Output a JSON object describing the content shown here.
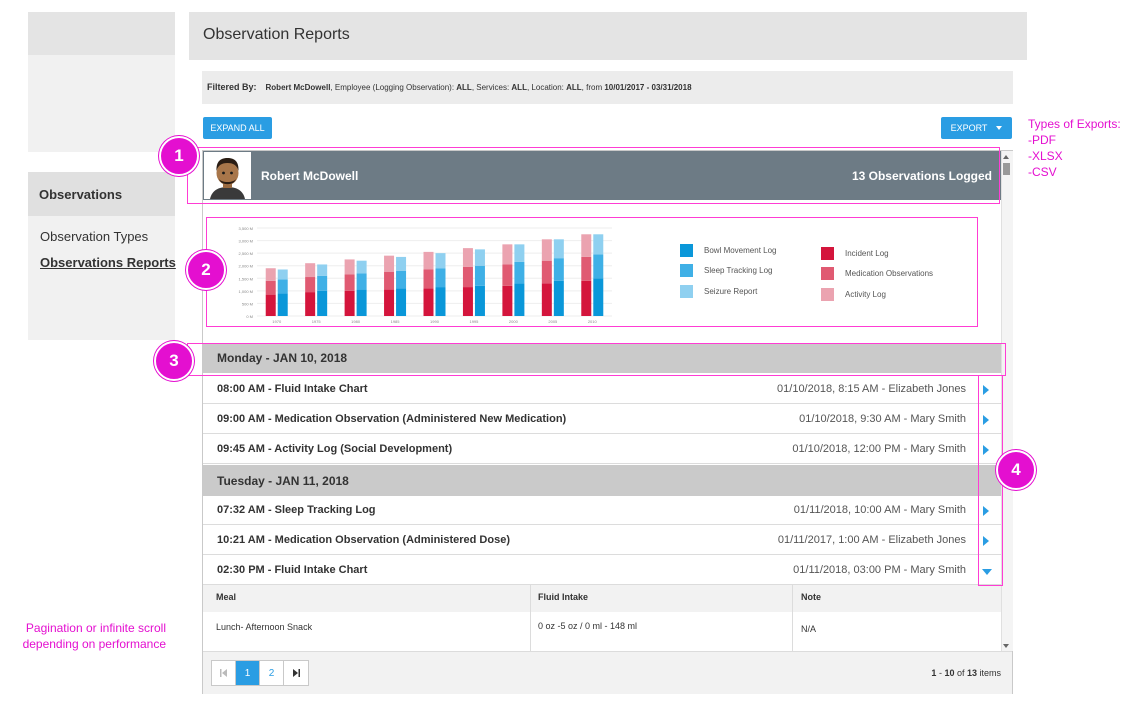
{
  "header": {
    "title": "Observation Reports"
  },
  "nav": {
    "header": "Observations",
    "items": [
      {
        "label": "Observation Types"
      },
      {
        "label": "Observations Reports"
      }
    ]
  },
  "filter": {
    "label": "Filtered By:",
    "name": "Robert McDowell",
    "employee_label": ", Employee (Logging Observation): ",
    "employee_value": "ALL",
    "services_label": ", Services: ",
    "services_value": "ALL",
    "location_label": ", Location: ",
    "location_value": "ALL",
    "from_label": ", from ",
    "date_range": "10/01/2017 - 03/31/2018"
  },
  "buttons": {
    "expand_all": "EXPAND ALL",
    "export": "EXPORT"
  },
  "user": {
    "name": "Robert McDowell",
    "count": "13 Observations Logged"
  },
  "chart_data": {
    "type": "bar",
    "categories": [
      "1970",
      "1975",
      "1980",
      "1985",
      "1990",
      "1995",
      "2000",
      "2005",
      "2010"
    ],
    "yticks": [
      "3,500 M",
      "3,000 M",
      "2,500 M",
      "2,000 M",
      "1,500 M",
      "1,000 M",
      "500 M",
      "0 M"
    ],
    "ylim": [
      0,
      3500
    ],
    "series": [
      {
        "name": "Bowl Movement Log",
        "stack": "b",
        "values": [
          900,
          1000,
          1050,
          1100,
          1150,
          1200,
          1300,
          1400,
          1500
        ]
      },
      {
        "name": "Sleep Tracking Log",
        "stack": "b",
        "values": [
          550,
          600,
          650,
          700,
          750,
          800,
          850,
          900,
          950
        ]
      },
      {
        "name": "Seizure Report",
        "stack": "b",
        "values": [
          400,
          450,
          500,
          550,
          600,
          650,
          700,
          750,
          800
        ]
      },
      {
        "name": "Incident Log",
        "stack": "a",
        "values": [
          850,
          950,
          1000,
          1050,
          1100,
          1150,
          1200,
          1300,
          1400
        ]
      },
      {
        "name": "Medication Observations",
        "stack": "a",
        "values": [
          550,
          600,
          650,
          700,
          750,
          800,
          850,
          900,
          950
        ]
      },
      {
        "name": "Activity Log",
        "stack": "a",
        "values": [
          500,
          550,
          600,
          650,
          700,
          750,
          800,
          850,
          900
        ]
      }
    ],
    "colors": {
      "Bowl Movement Log": "#0a97d9",
      "Sleep Tracking Log": "#3fb0e6",
      "Seizure Report": "#8fd0f0",
      "Incident Log": "#d4153c",
      "Medication Observations": "#e05a72",
      "Activity Log": "#eba3b0"
    },
    "legend_position": "right"
  },
  "days": [
    {
      "date": "Monday - JAN 10, 2018",
      "rows": [
        {
          "title": "08:00 AM - Fluid Intake Chart",
          "meta": "01/10/2018, 8:15 AM - Elizabeth Jones"
        },
        {
          "title": "09:00 AM - Medication Observation (Administered New Medication)",
          "meta": "01/10/2018, 9:30 AM - Mary Smith"
        },
        {
          "title": "09:45 AM - Activity Log (Social Development)",
          "meta": "01/10/2018, 12:00 PM - Mary Smith"
        }
      ]
    },
    {
      "date": "Tuesday - JAN 11, 2018",
      "rows": [
        {
          "title": "07:32 AM - Sleep Tracking Log",
          "meta": "01/11/2018, 10:00 AM - Mary Smith"
        },
        {
          "title": "10:21 AM - Medication Observation (Administered Dose)",
          "meta": "01/11/2017, 1:00 AM - Elizabeth Jones"
        },
        {
          "title": "02:30 PM - Fluid Intake Chart",
          "meta": "01/11/2018, 03:00 PM - Mary Smith"
        }
      ]
    }
  ],
  "detail": {
    "headers": [
      "Meal",
      "Fluid Intake",
      "Note"
    ],
    "row": [
      "Lunch- Afternoon Snack",
      "0 oz -5 oz / 0 ml - 148 ml",
      "N/A"
    ]
  },
  "pager": {
    "pages": [
      "1",
      "2"
    ],
    "first_icon": "first-page-icon",
    "last_icon": "last-page-icon",
    "range_start": "1",
    "range_mid": " - ",
    "range_end": "10",
    "of_label": " of ",
    "total": "13",
    "items_label": " items"
  },
  "annotations": {
    "badges": [
      "1",
      "2",
      "3",
      "4"
    ],
    "exports_note": [
      "Types of Exports:",
      "-PDF",
      "-XLSX",
      "-CSV"
    ],
    "pagination_note": [
      "Pagination or infinite scroll",
      "depending on performance"
    ],
    "color": "#e40fd0"
  }
}
